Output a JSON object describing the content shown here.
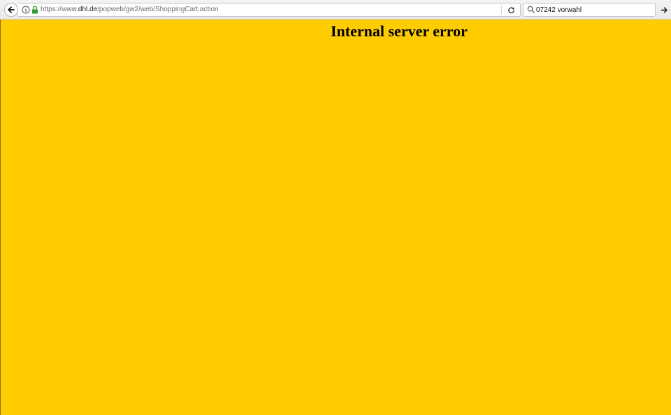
{
  "browser": {
    "url_prefix": "https://www.",
    "url_host": "dhl.de",
    "url_path": "/popweb/gw2/web/ShoppingCart.action",
    "search": {
      "value": "07242 vorwahl"
    },
    "icons": {
      "back": "back-arrow-icon",
      "info": "info-icon",
      "lock": "lock-icon",
      "reload": "reload-icon",
      "search": "magnifier-icon",
      "go": "go-arrow-icon"
    }
  },
  "page": {
    "heading": "Internal server error",
    "background_color": "#ffcc00"
  }
}
